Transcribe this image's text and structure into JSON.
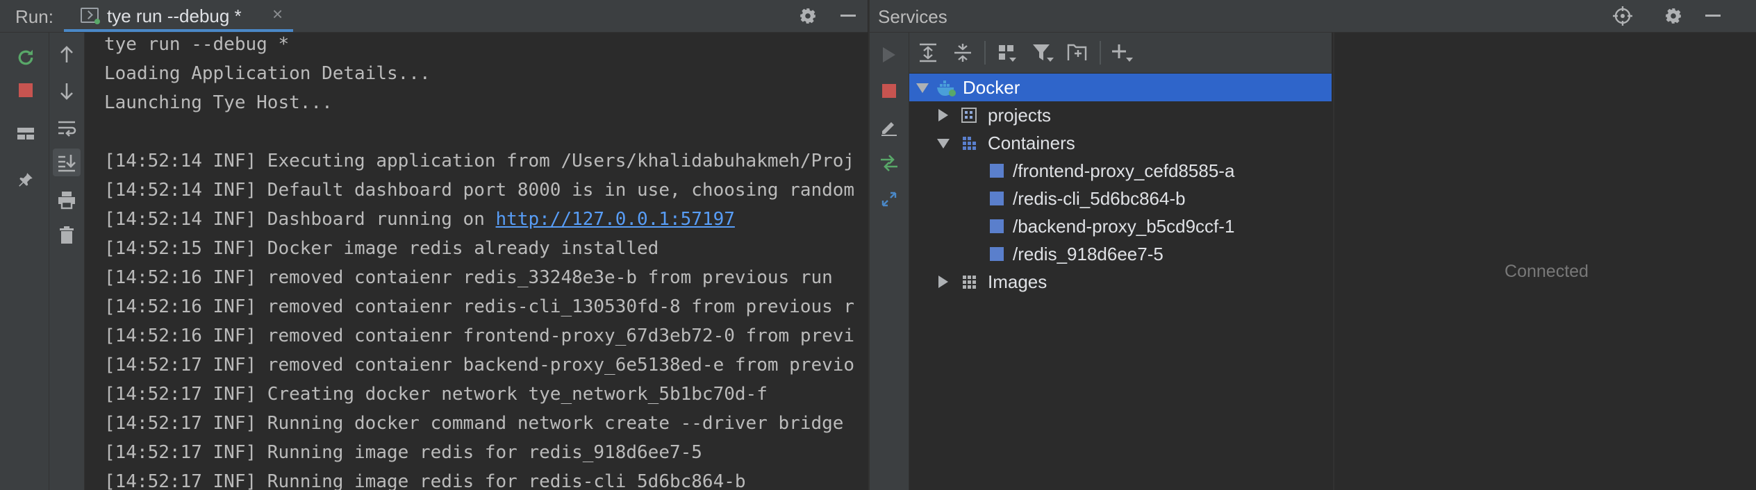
{
  "run": {
    "title": "Run:",
    "tab": {
      "label": "tye run --debug *",
      "close": "×"
    },
    "console_lines": [
      "tye run --debug *",
      "Loading Application Details...",
      "Launching Tye Host...",
      "",
      "[14:52:14 INF] Executing application from /Users/khalidabuhakmeh/Proj",
      "[14:52:14 INF] Default dashboard port 8000 is in use, choosing random",
      "[14:52:14 INF] Dashboard running on ",
      "[14:52:15 INF] Docker image redis already installed",
      "[14:52:16 INF] removed contaienr redis_33248e3e-b from previous run",
      "[14:52:16 INF] removed contaienr redis-cli_130530fd-8 from previous r",
      "[14:52:16 INF] removed contaienr frontend-proxy_67d3eb72-0 from previ",
      "[14:52:17 INF] removed contaienr backend-proxy_6e5138ed-e from previo",
      "[14:52:17 INF] Creating docker network tye_network_5b1bc70d-f",
      "[14:52:17 INF] Running docker command network create --driver bridge",
      "[14:52:17 INF] Running image redis for redis_918d6ee7-5",
      "[14:52:17 INF] Running image redis for redis-cli_5d6bc864-b"
    ],
    "dashboard_link": "http://127.0.0.1:57197"
  },
  "services": {
    "title": "Services",
    "tree": {
      "docker": "Docker",
      "projects": "projects",
      "containers": "Containers",
      "container_items": [
        "/frontend-proxy_cefd8585-a",
        "/redis-cli_5d6bc864-b",
        "/backend-proxy_b5cd9ccf-1",
        "/redis_918d6ee7-5"
      ],
      "images": "Images"
    },
    "detail_status": "Connected"
  },
  "colors": {
    "selection": "#2f65ca",
    "link": "#589df6",
    "run_green": "#59a869",
    "stop_red": "#c75450",
    "container_blue": "#5a7fcc"
  }
}
